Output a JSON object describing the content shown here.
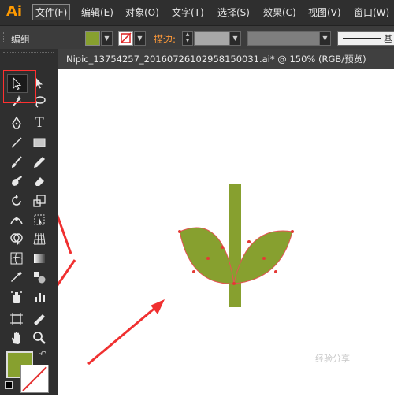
{
  "app": {
    "logo": "Ai"
  },
  "menu": {
    "items": [
      {
        "id": "file",
        "label": "文件(F)"
      },
      {
        "id": "edit",
        "label": "编辑(E)"
      },
      {
        "id": "object",
        "label": "对象(O)"
      },
      {
        "id": "type",
        "label": "文字(T)"
      },
      {
        "id": "select",
        "label": "选择(S)"
      },
      {
        "id": "effect",
        "label": "效果(C)"
      },
      {
        "id": "view",
        "label": "视图(V)"
      },
      {
        "id": "window",
        "label": "窗口(W)"
      }
    ]
  },
  "control_bar": {
    "selection_label": "编组",
    "fill_color": "#87a02f",
    "stroke_label": "描边:",
    "stroke_weight": "",
    "style_label": "基"
  },
  "document": {
    "tab_title": "Nipic_13754257_20160726102958150031.ai* @ 150% (RGB/预览)"
  },
  "tools": [
    {
      "id": "selection",
      "icon": "selection-arrow-icon"
    },
    {
      "id": "direct-selection",
      "icon": "direct-selection-icon"
    },
    {
      "id": "magic-wand",
      "icon": "magic-wand-icon"
    },
    {
      "id": "lasso",
      "icon": "lasso-icon"
    },
    {
      "id": "pen",
      "icon": "pen-icon"
    },
    {
      "id": "type",
      "icon": "type-icon",
      "glyph": "T"
    },
    {
      "id": "line",
      "icon": "line-segment-icon"
    },
    {
      "id": "rectangle",
      "icon": "rectangle-icon"
    },
    {
      "id": "paintbrush",
      "icon": "paintbrush-icon"
    },
    {
      "id": "pencil",
      "icon": "pencil-icon"
    },
    {
      "id": "blob-brush",
      "icon": "blob-brush-icon"
    },
    {
      "id": "eraser",
      "icon": "eraser-icon"
    },
    {
      "id": "rotate",
      "icon": "rotate-icon"
    },
    {
      "id": "scale",
      "icon": "scale-icon"
    },
    {
      "id": "width",
      "icon": "width-tool-icon"
    },
    {
      "id": "free-transform",
      "icon": "free-transform-icon"
    },
    {
      "id": "shape-builder",
      "icon": "shape-builder-icon"
    },
    {
      "id": "perspective-grid",
      "icon": "perspective-grid-icon"
    },
    {
      "id": "mesh",
      "icon": "mesh-icon"
    },
    {
      "id": "gradient",
      "icon": "gradient-icon"
    },
    {
      "id": "eyedropper",
      "icon": "eyedropper-icon"
    },
    {
      "id": "blend",
      "icon": "blend-icon"
    },
    {
      "id": "symbol-sprayer",
      "icon": "symbol-sprayer-icon"
    },
    {
      "id": "column-graph",
      "icon": "column-graph-icon"
    },
    {
      "id": "artboard",
      "icon": "artboard-icon"
    },
    {
      "id": "slice",
      "icon": "slice-icon"
    },
    {
      "id": "hand",
      "icon": "hand-icon"
    },
    {
      "id": "zoom",
      "icon": "zoom-icon"
    }
  ],
  "swatches": {
    "fill": "#87a02f",
    "stroke": "none"
  },
  "artwork": {
    "stem_color": "#87a02f",
    "leaf_color": "#87a02f",
    "anchor_color": "#e53935"
  },
  "annotations": {
    "arrow_color": "#f03030"
  },
  "watermark": {
    "text": "经验分享"
  }
}
